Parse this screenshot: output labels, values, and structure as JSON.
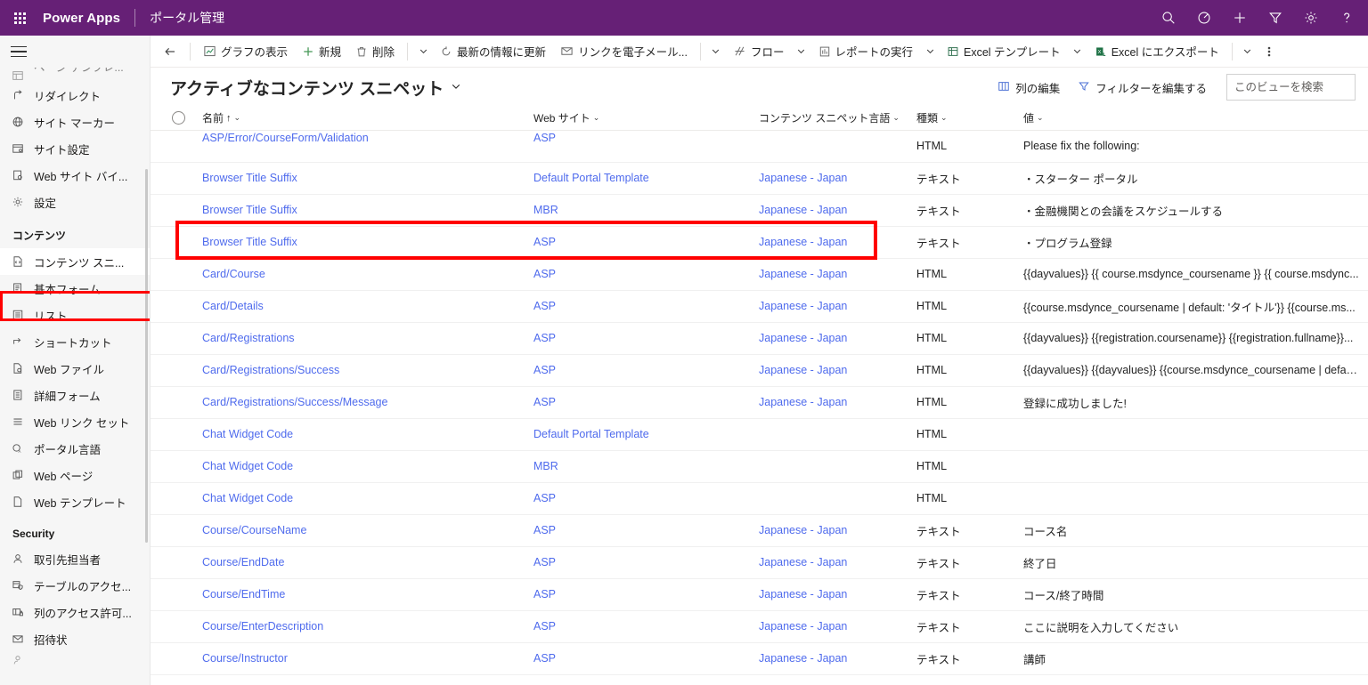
{
  "topbar": {
    "waffle_label": "app-launcher",
    "brand": "Power Apps",
    "app_name": "ポータル管理",
    "icons": [
      {
        "name": "search-icon",
        "label": "検索"
      },
      {
        "name": "diagnostics-icon",
        "label": "診断"
      },
      {
        "name": "plus-icon",
        "label": "新規作成"
      },
      {
        "name": "filter-icon",
        "label": "フィルター"
      },
      {
        "name": "gear-icon",
        "label": "設定"
      },
      {
        "name": "help-icon",
        "label": "ヘルプ"
      }
    ],
    "accent_color": "#662076"
  },
  "sidebar": {
    "hamburger_label": "サイト マップ",
    "partial_top_item": "ページ テンプレ...",
    "items": [
      {
        "label": "リダイレクト",
        "icon": "redirect-icon"
      },
      {
        "label": "サイト マーカー",
        "icon": "globe-icon"
      },
      {
        "label": "サイト設定",
        "icon": "site-settings-icon"
      },
      {
        "label": "Web サイト バイ...",
        "icon": "website-binding-icon"
      },
      {
        "label": "設定",
        "icon": "gear-icon"
      }
    ],
    "group_content_label": "コンテンツ",
    "content_items": [
      {
        "label": "コンテンツ スニ...",
        "icon": "content-snippet-icon",
        "selected": true
      },
      {
        "label": "基本フォーム",
        "icon": "basic-form-icon",
        "selected": false
      },
      {
        "label": "リスト",
        "icon": "list-icon",
        "selected": false
      },
      {
        "label": "ショートカット",
        "icon": "shortcut-icon",
        "selected": false
      },
      {
        "label": "Web ファイル",
        "icon": "web-file-icon",
        "selected": false
      },
      {
        "label": "詳細フォーム",
        "icon": "advanced-form-icon",
        "selected": false
      },
      {
        "label": "Web リンク セット",
        "icon": "web-link-set-icon",
        "selected": false
      },
      {
        "label": "ポータル言語",
        "icon": "portal-language-icon",
        "selected": false
      },
      {
        "label": "Web ページ",
        "icon": "web-page-icon",
        "selected": false
      },
      {
        "label": "Web テンプレート",
        "icon": "web-template-icon",
        "selected": false
      }
    ],
    "group_security_label": "Security",
    "security_items": [
      {
        "label": "取引先担当者",
        "icon": "contact-icon"
      },
      {
        "label": "テーブルのアクセ...",
        "icon": "table-permission-icon"
      },
      {
        "label": "列のアクセス許可...",
        "icon": "column-permission-icon"
      },
      {
        "label": "招待状",
        "icon": "invitation-icon"
      }
    ]
  },
  "commandbar": {
    "back_label": "戻る",
    "show_chart": "グラフの表示",
    "new": "新規",
    "delete": "削除",
    "refresh": "最新の情報に更新",
    "email_link": "リンクを電子メール...",
    "flow": "フロー",
    "run_report": "レポートの実行",
    "excel_templates": "Excel テンプレート",
    "export_excel": "Excel にエクスポート",
    "more_commands": "その他のコマンド"
  },
  "view": {
    "title": "アクティブなコンテンツ スニペット",
    "edit_columns": "列の編集",
    "edit_filters": "フィルターを編集する",
    "search_placeholder": "このビューを検索",
    "search_value": ""
  },
  "table": {
    "columns": [
      {
        "label": "名前",
        "sort": "↑",
        "name": "col-name"
      },
      {
        "label": "Web サイト",
        "sort": "",
        "name": "col-website"
      },
      {
        "label": "コンテンツ スニペット言語",
        "sort": "",
        "name": "col-language"
      },
      {
        "label": "種類",
        "sort": "",
        "name": "col-type"
      },
      {
        "label": "値",
        "sort": "",
        "name": "col-value"
      }
    ],
    "partial_row": {
      "name": "ASP/Error/CourseForm/Validation",
      "website": "ASP",
      "language": "",
      "type": "HTML",
      "value": "Please fix the following:"
    },
    "rows": [
      {
        "name": "Browser Title Suffix",
        "website": "Default Portal Template",
        "language": "Japanese - Japan",
        "type": "テキスト",
        "value": "・スターター ポータル",
        "highlighted": false
      },
      {
        "name": "Browser Title Suffix",
        "website": "MBR",
        "language": "Japanese - Japan",
        "type": "テキスト",
        "value": "・金融機関との会議をスケジュールする",
        "highlighted": false
      },
      {
        "name": "Browser Title Suffix",
        "website": "ASP",
        "language": "Japanese - Japan",
        "type": "テキスト",
        "value": "・プログラム登録",
        "highlighted": false
      },
      {
        "name": "Card/Course",
        "website": "ASP",
        "language": "Japanese - Japan",
        "type": "HTML",
        "value": "{{dayvalues}} {{ course.msdynce_coursename }} {{ course.msdync...",
        "highlighted": true
      },
      {
        "name": "Card/Details",
        "website": "ASP",
        "language": "Japanese - Japan",
        "type": "HTML",
        "value": "{{course.msdynce_coursename | default: 'タイトル'}} {{course.ms...",
        "highlighted": false
      },
      {
        "name": "Card/Registrations",
        "website": "ASP",
        "language": "Japanese - Japan",
        "type": "HTML",
        "value": "{{dayvalues}} {{registration.coursename}} {{registration.fullname}}...",
        "highlighted": false
      },
      {
        "name": "Card/Registrations/Success",
        "website": "ASP",
        "language": "Japanese - Japan",
        "type": "HTML",
        "value": "{{dayvalues}} {{dayvalues}} {{course.msdynce_coursename | defau...",
        "highlighted": false
      },
      {
        "name": "Card/Registrations/Success/Message",
        "website": "ASP",
        "language": "Japanese - Japan",
        "type": "HTML",
        "value": "登録に成功しました!",
        "highlighted": false
      },
      {
        "name": "Chat Widget Code",
        "website": "Default Portal Template",
        "language": "",
        "type": "HTML",
        "value": "",
        "highlighted": false
      },
      {
        "name": "Chat Widget Code",
        "website": "MBR",
        "language": "",
        "type": "HTML",
        "value": "",
        "highlighted": false
      },
      {
        "name": "Chat Widget Code",
        "website": "ASP",
        "language": "",
        "type": "HTML",
        "value": "",
        "highlighted": false
      },
      {
        "name": "Course/CourseName",
        "website": "ASP",
        "language": "Japanese - Japan",
        "type": "テキスト",
        "value": "コース名",
        "highlighted": false
      },
      {
        "name": "Course/EndDate",
        "website": "ASP",
        "language": "Japanese - Japan",
        "type": "テキスト",
        "value": "終了日",
        "highlighted": false
      },
      {
        "name": "Course/EndTime",
        "website": "ASP",
        "language": "Japanese - Japan",
        "type": "テキスト",
        "value": "コース/終了時間",
        "highlighted": false
      },
      {
        "name": "Course/EnterDescription",
        "website": "ASP",
        "language": "Japanese - Japan",
        "type": "テキスト",
        "value": "ここに説明を入力してください",
        "highlighted": false
      },
      {
        "name": "Course/Instructor",
        "website": "ASP",
        "language": "Japanese - Japan",
        "type": "テキスト",
        "value": "講師",
        "highlighted": false
      }
    ]
  },
  "annotation": {
    "color": "#ff0000",
    "targets": [
      "sidebar-item-content-snippets",
      "table-row-card-course"
    ]
  }
}
